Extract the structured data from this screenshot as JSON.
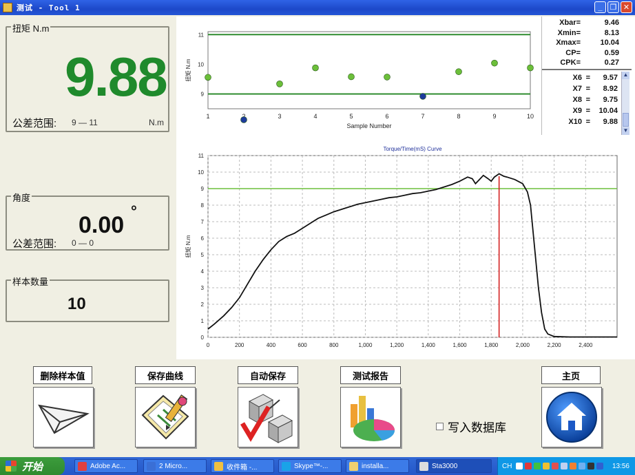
{
  "window": {
    "title": "测试 - Tool 1"
  },
  "torque_panel": {
    "label": "扭矩 N.m",
    "value": "9.88",
    "tolerance_label": "公差范围:",
    "tolerance_range": "9 — 11",
    "unit": "N.m"
  },
  "angle_panel": {
    "label": "角度",
    "value": "0.00",
    "degree_symbol": "°",
    "tolerance_label": "公差范围:",
    "tolerance_range": "0 — 0"
  },
  "count_panel": {
    "label": "样本数量",
    "value": "10"
  },
  "stats": {
    "summary": [
      {
        "key": "Xbar=",
        "value": "9.46"
      },
      {
        "key": "Xmin=",
        "value": "8.13"
      },
      {
        "key": "Xmax=",
        "value": "10.04"
      },
      {
        "key": "CP=",
        "value": "0.59"
      },
      {
        "key": "CPK=",
        "value": "0.27"
      }
    ],
    "samples": [
      {
        "key": "X6",
        "value": "9.57"
      },
      {
        "key": "X7",
        "value": "8.92"
      },
      {
        "key": "X8",
        "value": "9.75"
      },
      {
        "key": "X9",
        "value": "10.04"
      },
      {
        "key": "X10",
        "value": "9.88"
      }
    ]
  },
  "buttons": {
    "delete": "删除样本值",
    "save_curve": "保存曲线",
    "auto_save": "自动保存",
    "report": "测试报告",
    "home": "主页"
  },
  "checkbox": {
    "label": "写入数据库",
    "checked": false
  },
  "taskbar": {
    "start": "开始",
    "tasks": [
      "Adobe Ac...",
      "2 Micro...",
      "收件箱 -...",
      "Skype™-...",
      "installa...",
      "Sta3000"
    ],
    "ime": "CH",
    "clock": "13:56"
  },
  "chart_data": [
    {
      "type": "scatter",
      "title": "",
      "xlabel": "Sample Number",
      "ylabel": "扭矩 N.m",
      "xlim": [
        1,
        10
      ],
      "ylim": [
        8.5,
        11.1
      ],
      "xticks": [
        1,
        2,
        3,
        4,
        5,
        6,
        7,
        8,
        9,
        10
      ],
      "yticks": [
        9,
        10,
        11
      ],
      "limits": {
        "upper": 11,
        "lower": 9
      },
      "x": [
        1,
        2,
        3,
        4,
        5,
        6,
        7,
        8,
        9,
        10
      ],
      "y": [
        9.56,
        8.13,
        9.34,
        9.88,
        9.58,
        9.57,
        8.92,
        9.75,
        10.04,
        9.88
      ],
      "point_colors": [
        "#6cbf3a",
        "#1e3c9c",
        "#6cbf3a",
        "#6cbf3a",
        "#6cbf3a",
        "#6cbf3a",
        "#1e3c9c",
        "#6cbf3a",
        "#6cbf3a",
        "#6cbf3a"
      ]
    },
    {
      "type": "line",
      "title": "Torque/Time(mS) Curve",
      "xlabel": "",
      "ylabel": "扭矩 N.m",
      "xlim": [
        0,
        2600
      ],
      "ylim": [
        0,
        11
      ],
      "xticks": [
        0,
        200,
        400,
        600,
        800,
        1000,
        1200,
        1400,
        1600,
        1800,
        2000,
        2200,
        2400
      ],
      "xtick_labels": [
        "0",
        "200",
        "400",
        "600",
        "800",
        "1,000",
        "1,200",
        "1,400",
        "1,600",
        "1,800",
        "2,000",
        "2,200",
        "2,400"
      ],
      "yticks": [
        0,
        1,
        2,
        3,
        4,
        5,
        6,
        7,
        8,
        9,
        10,
        11
      ],
      "grid": true,
      "limit_line": 9,
      "peak_marker_x": 1850,
      "x": [
        0,
        40,
        100,
        150,
        200,
        250,
        300,
        350,
        400,
        450,
        500,
        550,
        600,
        650,
        700,
        750,
        800,
        850,
        900,
        950,
        1000,
        1050,
        1100,
        1150,
        1200,
        1250,
        1300,
        1350,
        1400,
        1450,
        1500,
        1550,
        1600,
        1650,
        1680,
        1700,
        1720,
        1750,
        1780,
        1800,
        1820,
        1850,
        1880,
        1900,
        1950,
        2000,
        2030,
        2050,
        2060,
        2080,
        2100,
        2120,
        2140,
        2160,
        2200,
        2300,
        2400,
        2600
      ],
      "y": [
        0.5,
        0.8,
        1.3,
        1.8,
        2.4,
        3.2,
        4.0,
        4.7,
        5.3,
        5.8,
        6.1,
        6.3,
        6.6,
        6.9,
        7.2,
        7.4,
        7.6,
        7.75,
        7.9,
        8.05,
        8.15,
        8.25,
        8.35,
        8.45,
        8.5,
        8.6,
        8.7,
        8.75,
        8.85,
        8.95,
        9.1,
        9.25,
        9.45,
        9.7,
        9.6,
        9.3,
        9.5,
        9.8,
        9.6,
        9.45,
        9.7,
        9.9,
        9.75,
        9.7,
        9.55,
        9.3,
        8.8,
        8.0,
        7.0,
        5.0,
        3.0,
        1.5,
        0.5,
        0.2,
        0.05,
        0.02,
        0.02,
        0.02
      ]
    }
  ]
}
